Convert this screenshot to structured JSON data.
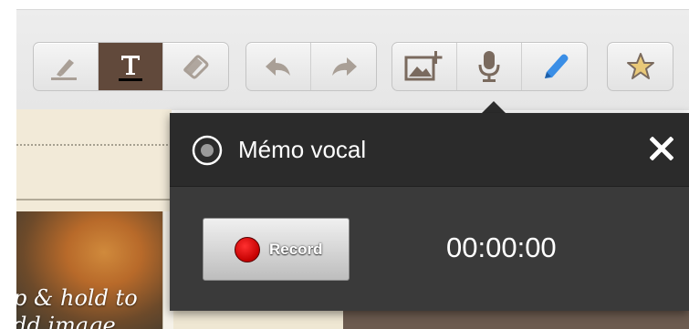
{
  "toolbar": {
    "groups": [
      {
        "name": "text-tools",
        "buttons": [
          "highlighter-icon",
          "text-icon",
          "eraser-icon"
        ]
      },
      {
        "name": "history",
        "buttons": [
          "undo-icon",
          "redo-icon"
        ]
      },
      {
        "name": "media",
        "buttons": [
          "add-image-icon",
          "microphone-icon",
          "pen-icon"
        ]
      },
      {
        "name": "favorite",
        "buttons": [
          "star-icon"
        ]
      }
    ],
    "active_button": "text-icon"
  },
  "card": {
    "photo_caption": "p & hold to\ndd image"
  },
  "memo_popup": {
    "title": "Mémo vocal",
    "record_label": "Record",
    "timer": "00:00:00"
  },
  "colors": {
    "popup_bg": "#3a3a3a",
    "popup_header_bg": "#2b2b2b",
    "active_tool_bg": "#61493b",
    "record_red": "#e00000",
    "pen_blue": "#3a8ee6",
    "icon_brown": "#7a6a5e"
  }
}
